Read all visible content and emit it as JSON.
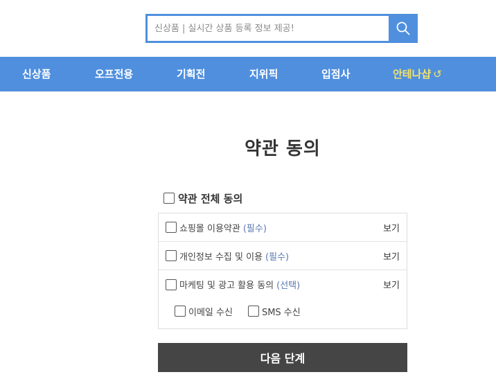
{
  "search": {
    "placeholder": "신상품 | 실시간 상품 등록 정보 제공!"
  },
  "nav": {
    "items": [
      {
        "label": "신상품"
      },
      {
        "label": "오프전용"
      },
      {
        "label": "기획전"
      },
      {
        "label": "지위픽"
      },
      {
        "label": "입점사"
      },
      {
        "label": "안테나샵",
        "suffix": "↺"
      }
    ]
  },
  "page": {
    "title": "약관 동의"
  },
  "agree_all": {
    "label": "약관 전체 동의"
  },
  "terms": [
    {
      "label": "쇼핑몰 이용약관",
      "tag": "(필수)",
      "view": "보기"
    },
    {
      "label": "개인정보 수집 및 이용",
      "tag": "(필수)",
      "view": "보기"
    },
    {
      "label": "마케팅 및 광고 활용 동의",
      "tag": "(선택)",
      "view": "보기"
    }
  ],
  "marketing_options": [
    {
      "label": "이메일 수신"
    },
    {
      "label": "SMS 수신"
    }
  ],
  "next_button": {
    "label": "다음 단계"
  },
  "colors": {
    "accent": "#4f8fde",
    "nav_highlight": "#f5e36b",
    "button_dark": "#454545",
    "tag_text": "#5b78b0"
  }
}
